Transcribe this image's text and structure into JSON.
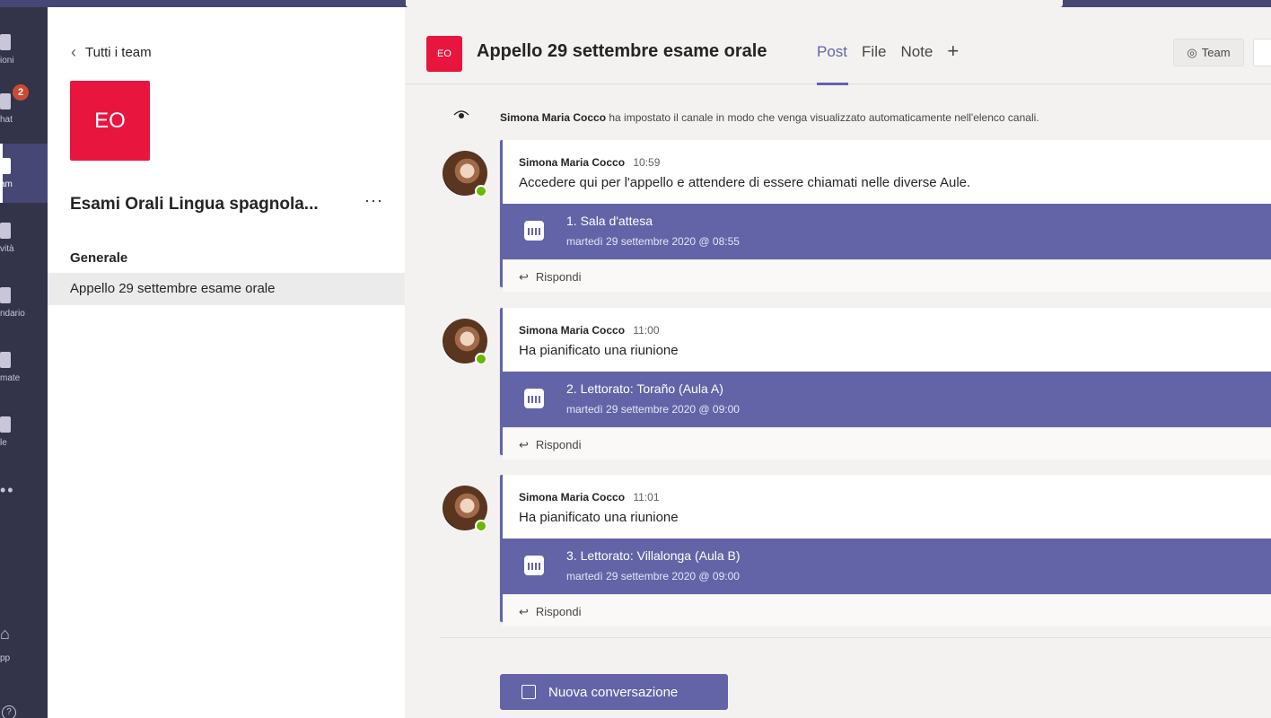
{
  "rail": {
    "items": [
      {
        "label": "ioni"
      },
      {
        "label": "hat"
      },
      {
        "label": "am"
      },
      {
        "label": "vità"
      },
      {
        "label": "ndario"
      },
      {
        "label": "mate"
      },
      {
        "label": "le"
      }
    ],
    "chat_badge": "2",
    "apps_label": "pp",
    "help_glyph": "?"
  },
  "panel": {
    "back_label": "Tutti i team",
    "team_initials": "EO",
    "team_name": "Esami Orali Lingua spagnola...",
    "more_glyph": "···",
    "section_label": "Generale",
    "channel_name": "Appello 29 settembre esame orale"
  },
  "header": {
    "avatar_initials": "EO",
    "title": "Appello 29 settembre esame orale",
    "tabs": [
      "Post",
      "File",
      "Note"
    ],
    "add_tab": "+",
    "team_button": "Team"
  },
  "system_message": {
    "author": "Simona Maria Cocco",
    "text": " ha impostato il canale in modo che venga visualizzato automaticamente nell'elenco canali."
  },
  "posts": [
    {
      "author": "Simona Maria Cocco",
      "time": "10:59",
      "body": "Accedere qui per l'appello e attendere di essere chiamati nelle diverse Aule.",
      "meeting_title": "1. Sala d'attesa",
      "meeting_date": "martedì 29 settembre 2020 @ 08:55",
      "reply": "Rispondi"
    },
    {
      "author": "Simona Maria Cocco",
      "time": "11:00",
      "body": "Ha pianificato una riunione",
      "meeting_title": "2. Lettorato: Toraño (Aula A)",
      "meeting_date": "martedì 29 settembre 2020 @ 09:00",
      "reply": "Rispondi"
    },
    {
      "author": "Simona Maria Cocco",
      "time": "11:01",
      "body": "Ha pianificato una riunione",
      "meeting_title": "3. Lettorato: Villalonga (Aula B)",
      "meeting_date": "martedì 29 settembre 2020 @ 09:00",
      "reply": "Rispondi"
    }
  ],
  "new_conversation": "Nuova conversazione",
  "colors": {
    "accent": "#6264a7",
    "team_avatar": "#e8163f",
    "rail": "#33344a",
    "presence": "#6bb700"
  }
}
